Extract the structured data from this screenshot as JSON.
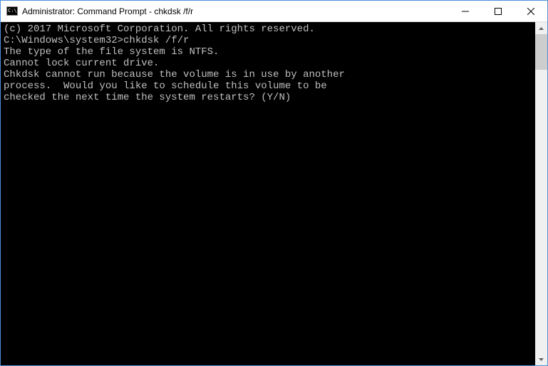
{
  "window": {
    "title": "Administrator: Command Prompt - chkdsk  /f/r"
  },
  "terminal": {
    "lines": [
      "(c) 2017 Microsoft Corporation. All rights reserved.",
      "",
      "C:\\Windows\\system32>chkdsk /f/r",
      "The type of the file system is NTFS.",
      "Cannot lock current drive.",
      "",
      "Chkdsk cannot run because the volume is in use by another",
      "process.  Would you like to schedule this volume to be",
      "checked the next time the system restarts? (Y/N)"
    ]
  }
}
